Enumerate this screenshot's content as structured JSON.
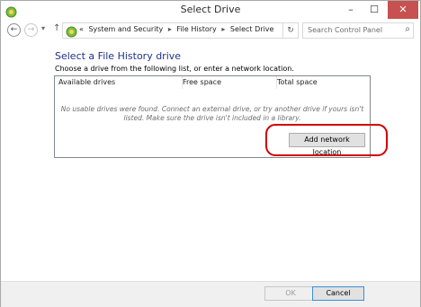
{
  "window": {
    "title": "Select Drive",
    "controls": {
      "minimize": "–",
      "maximize": "☐",
      "close": "✕"
    }
  },
  "address_bar": {
    "prefix": "«",
    "crumbs": [
      "System and Security",
      "File History",
      "Select Drive"
    ],
    "separator": "▸",
    "search_placeholder": "Search Control Panel"
  },
  "main": {
    "heading": "Select a File History drive",
    "instruction": "Choose a drive from the following list, or enter a network location.",
    "list": {
      "columns": [
        "Available drives",
        "Free space",
        "Total space"
      ],
      "empty_message": "No usable drives were found. Connect an external drive, or try another drive if yours isn't listed. Make sure the drive isn't included in a library."
    },
    "add_network_button": "Add network location"
  },
  "footer": {
    "ok_label": "OK",
    "cancel_label": "Cancel"
  },
  "colors": {
    "heading": "#1e3287",
    "highlight": "#d10000",
    "close_button": "#c75050"
  },
  "icons": [
    "control-panel-icon",
    "back-arrow-icon",
    "forward-arrow-icon",
    "up-arrow-icon",
    "refresh-icon",
    "search-icon"
  ]
}
